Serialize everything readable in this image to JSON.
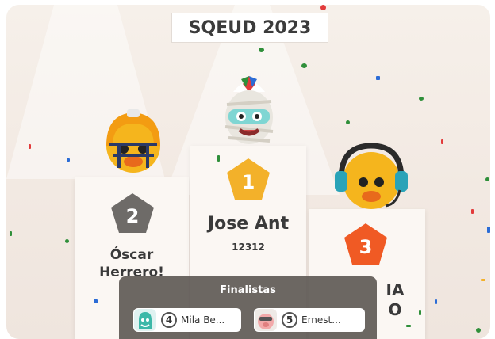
{
  "event_title": "SQEUD 2023",
  "podium": [
    {
      "rank": "1",
      "name": "Jose Ant",
      "score": "12312",
      "badge_color": "#f3b12a"
    },
    {
      "rank": "2",
      "name_line1": "Óscar",
      "name_line2": "Herrero!",
      "badge_color": "#6e6b68"
    },
    {
      "rank": "3",
      "name_line1": "IA",
      "name_line2": "O",
      "badge_color": "#f05a24"
    }
  ],
  "finalists": {
    "title": "Finalistas",
    "items": [
      {
        "rank": "4",
        "name": "Mila Be..."
      },
      {
        "rank": "5",
        "name": "Ernest..."
      }
    ]
  },
  "colors": {
    "confetti_green": "#2f8f3a",
    "confetti_red": "#e23b3b",
    "confetti_blue": "#2b6cd6"
  }
}
